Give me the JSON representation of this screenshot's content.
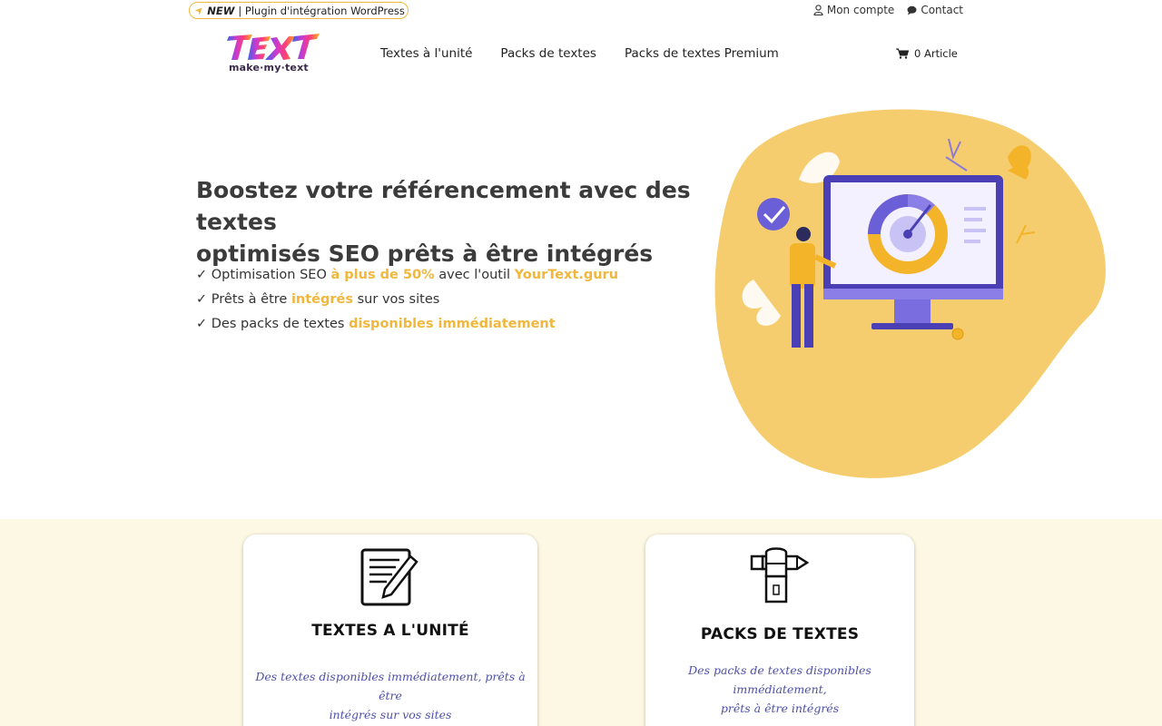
{
  "topbar": {
    "new_label": "NEW",
    "plugin_text": "| Plugin d'intégration WordPress",
    "account": "Mon compte",
    "contact": "Contact"
  },
  "brand": {
    "logo_letters": "TEXT",
    "tagline": "make·my·text"
  },
  "nav": {
    "items": [
      "Textes à l'unité",
      "Packs de textes",
      "Packs de textes Premium"
    ],
    "cart": "0 Article"
  },
  "hero": {
    "title_line1": "Boostez votre référencement avec des textes",
    "title_line2": "optimisés SEO prêts à être intégrés",
    "bullets": [
      {
        "check": "✓",
        "pre": "Optimisation SEO ",
        "hl": "à plus de 50%",
        "mid": " avec l'outil ",
        "hl2": "YourText.guru",
        "post": ""
      },
      {
        "check": "✓",
        "pre": "Prêts à être ",
        "hl": "intégrés",
        "mid": " sur vos sites",
        "hl2": "",
        "post": ""
      },
      {
        "check": "✓",
        "pre": "Des packs de textes ",
        "hl": "disponibles immédiatement",
        "mid": "",
        "hl2": "",
        "post": ""
      }
    ]
  },
  "cards": [
    {
      "title": "TEXTES A L'UNITÉ",
      "desc_line1": "Des textes disponibles immédiatement, prêts à être",
      "desc_line2": "intégrés sur vos sites",
      "icon": "document-pen-icon"
    },
    {
      "title": "PACKS DE TEXTES",
      "desc_line1": "Des packs de textes disponibles immédiatement,",
      "desc_line2": "prêts à être intégrés",
      "icon": "hand-pencil-icon"
    }
  ],
  "colors": {
    "accent": "#f0b73c",
    "blob": "#f6cd6e",
    "purple": "#4d4fa8",
    "section_bg": "#fdf8e3"
  }
}
